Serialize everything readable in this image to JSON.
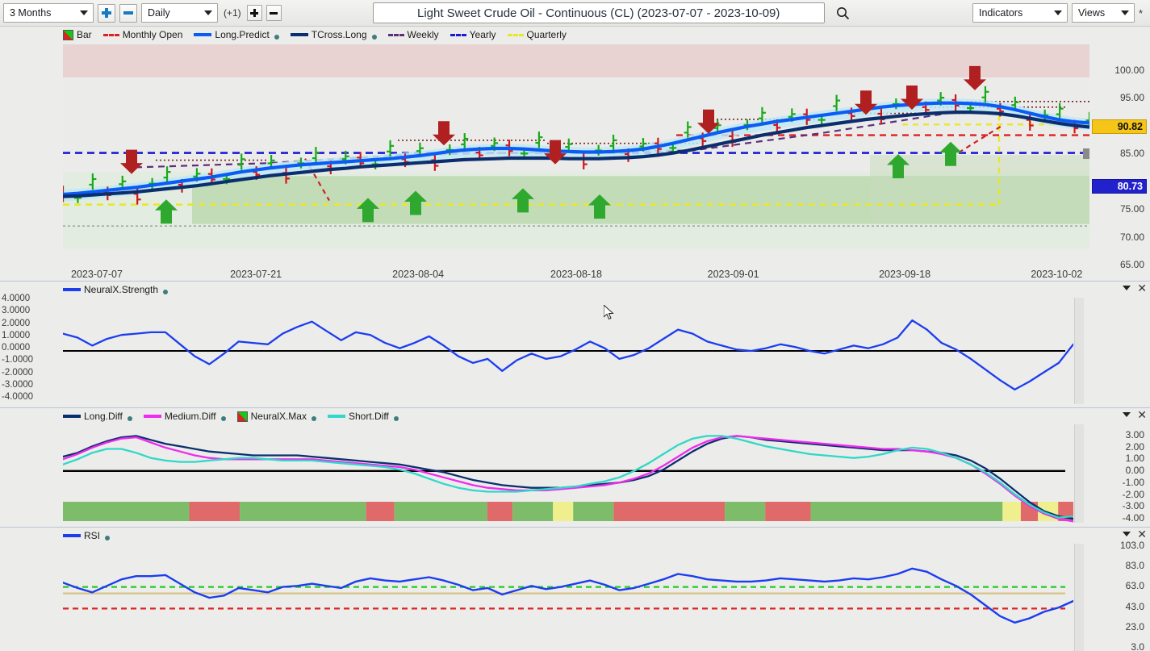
{
  "toolbar": {
    "range_value": "3 Months",
    "interval_value": "Daily",
    "offset_label": "(+1)",
    "symbol_title": "Light Sweet Crude Oil - Continuous (CL) (2023-07-07 - 2023-10-09)",
    "search_icon": "search-icon",
    "indicators_label": "Indicators",
    "views_label": "Views",
    "asterisk": "*",
    "zoom_in_icon": "plus-icon",
    "zoom_out_icon": "minus-icon",
    "bars_add_icon": "plus-icon",
    "bars_remove_icon": "minus-icon"
  },
  "main_chart": {
    "legend": [
      {
        "label": "Bar",
        "type": "bar",
        "color": "#22bb22"
      },
      {
        "label": "Monthly Open",
        "type": "dash",
        "color": "#e02020"
      },
      {
        "label": "Long.Predict",
        "type": "solid",
        "color": "#0a5cf5",
        "dot": true
      },
      {
        "label": "TCross.Long",
        "type": "solid",
        "color": "#0b2f6e",
        "dot": true
      },
      {
        "label": "Weekly",
        "type": "dash",
        "color": "#5c2f7a"
      },
      {
        "label": "Yearly",
        "type": "dash",
        "color": "#1b1bd6"
      },
      {
        "label": "Quarterly",
        "type": "dash",
        "color": "#e8e82a"
      }
    ],
    "price_tag_high": "90.82",
    "price_tag_low": "80.73",
    "price_tag_high_color": "#f5c518",
    "price_tag_low_color": "#2222cc"
  },
  "neuralx_panel": {
    "legend": [
      {
        "label": "NeuralX.Strength",
        "color": "#1b3df0",
        "dot": true
      }
    ],
    "collapse_icon": "chevron-down-icon",
    "close_icon": "close-icon"
  },
  "diff_panel": {
    "legend": [
      {
        "label": "Long.Diff",
        "color": "#0b2f6e",
        "dot": true
      },
      {
        "label": "Medium.Diff",
        "color": "#ef2bef",
        "dot": true
      },
      {
        "label": "NeuralX.Max",
        "type": "bar",
        "color": "#cc2222",
        "dot": true
      },
      {
        "label": "Short.Diff",
        "color": "#2fd8c8",
        "dot": true
      }
    ],
    "collapse_icon": "chevron-down-icon",
    "close_icon": "close-icon"
  },
  "rsi_panel": {
    "legend": [
      {
        "label": "RSI",
        "color": "#1b3df0",
        "dot": true
      }
    ],
    "collapse_icon": "chevron-down-icon",
    "close_icon": "close-icon"
  },
  "chart_data": [
    {
      "id": "main",
      "type": "line",
      "title": "Light Sweet Crude Oil - Continuous (CL)",
      "subtitle": "2023-07-07 - 2023-10-09",
      "xlabel": "",
      "ylabel": "",
      "ylim": [
        62.0,
        102.0
      ],
      "yticks": [
        100.0,
        95.0,
        85.0,
        75.0,
        70.0,
        65.0
      ],
      "ytick_labels": [
        "100.00",
        "95.00",
        "85.00",
        "75.00",
        "70.00",
        "65.00"
      ],
      "xticks": [
        "2023-07-07",
        "2023-07-21",
        "2023-08-04",
        "2023-08-18",
        "2023-09-01",
        "2023-09-18",
        "2023-10-02"
      ],
      "grid": false,
      "legend_position": "top-left",
      "annotations": {
        "marker_high": 90.82,
        "marker_low": 80.73,
        "yearly_level": 80.73,
        "quarterly_level": 70.6
      },
      "series": [
        {
          "name": "Long.Predict",
          "color": "#0a5cf5",
          "values": [
            72.6,
            72.8,
            73.1,
            73.4,
            73.7,
            74.0,
            74.4,
            74.8,
            75.2,
            75.6,
            76.0,
            76.5,
            77.0,
            77.4,
            77.8,
            78.1,
            78.4,
            78.6,
            78.8,
            79.0,
            79.2,
            79.4,
            79.6,
            79.9,
            80.2,
            80.6,
            81.0,
            81.3,
            81.5,
            81.6,
            81.6,
            81.5,
            81.3,
            81.1,
            81.0,
            80.9,
            80.9,
            81.0,
            81.2,
            81.5,
            82.0,
            82.6,
            83.3,
            84.0,
            84.7,
            85.3,
            85.9,
            86.4,
            86.9,
            87.3,
            87.7,
            88.1,
            88.5,
            88.9,
            89.3,
            89.7,
            90.0,
            90.2,
            90.4,
            90.5,
            90.5,
            90.4,
            90.2,
            89.8,
            89.2,
            88.5,
            87.8,
            87.2,
            86.8,
            86.6
          ]
        },
        {
          "name": "TCross.Long",
          "color": "#0b2f6e",
          "values": [
            72.2,
            72.3,
            72.5,
            72.7,
            72.9,
            73.1,
            73.4,
            73.7,
            74.0,
            74.3,
            74.7,
            75.1,
            75.5,
            75.9,
            76.3,
            76.6,
            76.9,
            77.2,
            77.5,
            77.7,
            78.0,
            78.2,
            78.4,
            78.6,
            78.8,
            79.0,
            79.2,
            79.4,
            79.5,
            79.6,
            79.7,
            79.7,
            79.7,
            79.7,
            79.6,
            79.6,
            79.6,
            79.7,
            79.8,
            80.0,
            80.3,
            80.7,
            81.2,
            81.8,
            82.4,
            83.0,
            83.6,
            84.2,
            84.7,
            85.2,
            85.7,
            86.1,
            86.5,
            86.9,
            87.3,
            87.6,
            87.9,
            88.2,
            88.4,
            88.6,
            88.7,
            88.7,
            88.6,
            88.4,
            88.0,
            87.5,
            87.0,
            86.5,
            86.1,
            85.8
          ]
        }
      ]
    },
    {
      "id": "neuralx-strength",
      "type": "line",
      "title": "NeuralX.Strength",
      "ylim": [
        -4.0,
        4.0
      ],
      "yticks": [
        4.0,
        3.0,
        2.0,
        1.0,
        0.0,
        -1.0,
        -2.0,
        -3.0,
        -4.0
      ],
      "ytick_labels": [
        "4.0000",
        "3.0000",
        "2.0000",
        "1.0000",
        "0.0000",
        "-1.0000",
        "-2.0000",
        "-3.0000",
        "-4.0000"
      ],
      "grid": false,
      "zero_line": 0.0,
      "series": [
        {
          "name": "NeuralX.Strength",
          "color": "#1b3df0",
          "values": [
            1.3,
            1.0,
            0.4,
            0.9,
            1.2,
            1.3,
            1.4,
            1.4,
            0.5,
            -0.4,
            -1.0,
            -0.2,
            0.7,
            0.6,
            0.5,
            1.3,
            1.8,
            2.2,
            1.5,
            0.8,
            1.4,
            1.2,
            0.6,
            0.2,
            0.6,
            1.1,
            0.4,
            -0.4,
            -0.9,
            -0.6,
            -1.5,
            -0.7,
            -0.2,
            -0.6,
            -0.4,
            0.1,
            0.7,
            0.2,
            -0.6,
            -0.3,
            0.2,
            0.9,
            1.6,
            1.3,
            0.7,
            0.4,
            0.1,
            0.0,
            0.2,
            0.5,
            0.3,
            0.0,
            -0.2,
            0.1,
            0.4,
            0.2,
            0.5,
            1.0,
            2.3,
            1.6,
            0.6,
            0.1,
            -0.6,
            -1.4,
            -2.2,
            -2.9,
            -2.3,
            -1.6,
            -0.9,
            0.5
          ]
        }
      ]
    },
    {
      "id": "diff",
      "type": "line",
      "title": "Long.Diff / Medium.Diff / Short.Diff",
      "ylim": [
        -4.0,
        3.6
      ],
      "yticks": [
        3.0,
        2.0,
        1.0,
        0.0,
        -1.0,
        -2.0,
        -3.0,
        -4.0
      ],
      "ytick_labels": [
        "3.00",
        "2.00",
        "1.00",
        "0.00",
        "-1.00",
        "-2.00",
        "-3.00",
        "-4.00"
      ],
      "grid": false,
      "zero_line": 0.0,
      "series": [
        {
          "name": "Long.Diff",
          "color": "#0b2f6e",
          "values": [
            1.1,
            1.4,
            1.9,
            2.3,
            2.6,
            2.7,
            2.4,
            2.1,
            1.9,
            1.7,
            1.5,
            1.4,
            1.3,
            1.2,
            1.2,
            1.2,
            1.2,
            1.1,
            1.0,
            0.9,
            0.8,
            0.7,
            0.6,
            0.5,
            0.3,
            0.1,
            -0.1,
            -0.4,
            -0.7,
            -0.9,
            -1.1,
            -1.2,
            -1.3,
            -1.3,
            -1.3,
            -1.2,
            -1.1,
            -1.0,
            -0.9,
            -0.7,
            -0.4,
            0.1,
            0.8,
            1.5,
            2.1,
            2.5,
            2.7,
            2.6,
            2.4,
            2.3,
            2.2,
            2.1,
            2.0,
            1.9,
            1.8,
            1.7,
            1.6,
            1.6,
            1.6,
            1.5,
            1.4,
            1.2,
            0.8,
            0.2,
            -0.6,
            -1.5,
            -2.4,
            -3.1,
            -3.5,
            -3.7
          ]
        },
        {
          "name": "Medium.Diff",
          "color": "#ef2bef",
          "values": [
            0.9,
            1.3,
            1.8,
            2.2,
            2.5,
            2.6,
            2.2,
            1.8,
            1.5,
            1.2,
            1.0,
            0.9,
            0.9,
            0.9,
            0.9,
            0.9,
            0.9,
            0.9,
            0.8,
            0.7,
            0.6,
            0.5,
            0.4,
            0.3,
            0.1,
            -0.2,
            -0.5,
            -0.8,
            -1.1,
            -1.3,
            -1.4,
            -1.5,
            -1.5,
            -1.5,
            -1.4,
            -1.3,
            -1.2,
            -1.1,
            -0.9,
            -0.6,
            -0.2,
            0.4,
            1.1,
            1.8,
            2.3,
            2.6,
            2.7,
            2.6,
            2.5,
            2.4,
            2.3,
            2.2,
            2.1,
            2.0,
            1.9,
            1.8,
            1.7,
            1.7,
            1.6,
            1.5,
            1.3,
            1.0,
            0.5,
            -0.2,
            -1.0,
            -1.9,
            -2.7,
            -3.3,
            -3.7,
            -3.9
          ]
        },
        {
          "name": "Short.Diff",
          "color": "#2fd8c8",
          "values": [
            0.5,
            0.9,
            1.4,
            1.7,
            1.7,
            1.4,
            1.0,
            0.8,
            0.7,
            0.7,
            0.8,
            0.9,
            1.0,
            1.0,
            0.9,
            0.8,
            0.8,
            0.8,
            0.7,
            0.6,
            0.5,
            0.4,
            0.3,
            0.1,
            -0.2,
            -0.6,
            -1.0,
            -1.3,
            -1.5,
            -1.6,
            -1.6,
            -1.6,
            -1.5,
            -1.4,
            -1.3,
            -1.2,
            -1.0,
            -0.8,
            -0.5,
            0.0,
            0.6,
            1.3,
            2.0,
            2.5,
            2.7,
            2.7,
            2.5,
            2.2,
            1.9,
            1.7,
            1.5,
            1.3,
            1.2,
            1.1,
            1.0,
            1.1,
            1.3,
            1.6,
            1.8,
            1.7,
            1.4,
            1.0,
            0.5,
            -0.1,
            -0.9,
            -1.8,
            -2.6,
            -3.2,
            -3.6,
            -3.5
          ]
        }
      ],
      "neuralx_max_bands": [
        {
          "start": 0.0,
          "end": 12.5,
          "color": "green"
        },
        {
          "start": 12.5,
          "end": 17.5,
          "color": "red"
        },
        {
          "start": 17.5,
          "end": 30.0,
          "color": "green"
        },
        {
          "start": 30.0,
          "end": 32.8,
          "color": "red"
        },
        {
          "start": 32.8,
          "end": 42.0,
          "color": "green"
        },
        {
          "start": 42.0,
          "end": 44.5,
          "color": "red"
        },
        {
          "start": 44.5,
          "end": 48.5,
          "color": "green"
        },
        {
          "start": 48.5,
          "end": 50.5,
          "color": "yellow"
        },
        {
          "start": 50.5,
          "end": 54.5,
          "color": "green"
        },
        {
          "start": 54.5,
          "end": 65.5,
          "color": "red"
        },
        {
          "start": 65.5,
          "end": 69.5,
          "color": "green"
        },
        {
          "start": 69.5,
          "end": 74.0,
          "color": "red"
        },
        {
          "start": 74.0,
          "end": 93.0,
          "color": "green"
        },
        {
          "start": 93.0,
          "end": 94.8,
          "color": "yellow"
        },
        {
          "start": 94.8,
          "end": 96.5,
          "color": "red"
        },
        {
          "start": 96.5,
          "end": 98.5,
          "color": "yellow"
        },
        {
          "start": 98.5,
          "end": 100.0,
          "color": "red"
        }
      ]
    },
    {
      "id": "rsi",
      "type": "line",
      "title": "RSI",
      "ylim": [
        3.0,
        103.0
      ],
      "yticks": [
        103.0,
        83.0,
        63.0,
        43.0,
        23.0,
        3.0
      ],
      "ytick_labels": [
        "103.0",
        "83.0",
        "63.0",
        "43.0",
        "23.0",
        "3.0"
      ],
      "grid": false,
      "reference_levels": [
        {
          "value": 63.0,
          "color": "#22cc22",
          "style": "dashed"
        },
        {
          "value": 57.0,
          "color": "#d6c48a",
          "style": "solid"
        },
        {
          "value": 43.0,
          "color": "#dd2222",
          "style": "dashed"
        }
      ],
      "series": [
        {
          "name": "RSI",
          "color": "#1b3df0",
          "values": [
            67,
            62,
            58,
            64,
            70,
            73,
            73,
            74,
            66,
            58,
            53,
            55,
            62,
            60,
            58,
            63,
            64,
            66,
            64,
            62,
            68,
            71,
            69,
            68,
            70,
            72,
            69,
            65,
            60,
            62,
            56,
            60,
            64,
            61,
            63,
            66,
            69,
            65,
            60,
            62,
            66,
            70,
            75,
            73,
            70,
            69,
            68,
            68,
            69,
            71,
            70,
            69,
            68,
            69,
            71,
            70,
            72,
            75,
            80,
            77,
            70,
            64,
            56,
            46,
            36,
            30,
            34,
            40,
            44,
            50
          ]
        }
      ]
    }
  ]
}
